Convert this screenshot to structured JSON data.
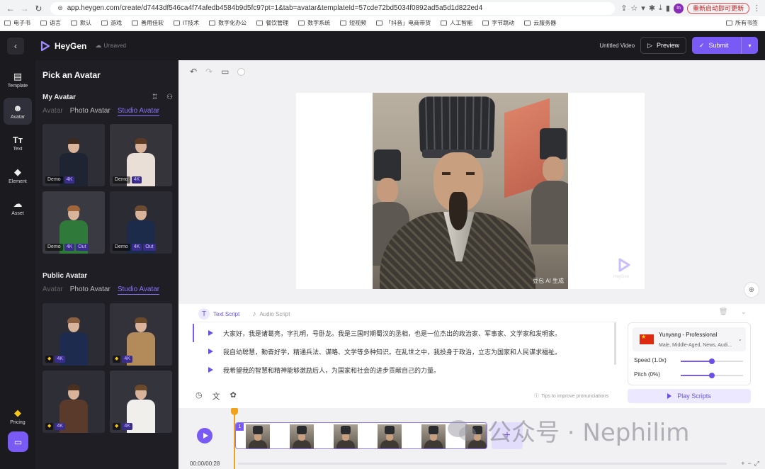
{
  "browser": {
    "url": "app.heygen.com/create/d7443df546ca4f74afedb4584b9d5fc9?pt=1&tab=avatar&templateId=57cde72bd5034f0892ad5a5d1d822ed4",
    "profile_initials": "In",
    "restart_label": "重新启动即可更新",
    "bookmarks": [
      "电子书",
      "语言",
      "默认",
      "游戏",
      "善用佳软",
      "IT技术",
      "数字化办公",
      "餐饮管理",
      "数字系统",
      "短视频",
      "「抖音」电商带货",
      "人工智能",
      "字节跳动",
      "云服务器"
    ],
    "bookmarks_right": "所有书签"
  },
  "header": {
    "brand": "HeyGen",
    "save_status": "Unsaved",
    "video_title": "Untitled Video",
    "preview_label": "Preview",
    "submit_label": "Submit"
  },
  "rail": {
    "items": [
      {
        "label": "Template",
        "icon": "template-icon"
      },
      {
        "label": "Avatar",
        "icon": "avatar-icon"
      },
      {
        "label": "Text",
        "icon": "text-icon"
      },
      {
        "label": "Element",
        "icon": "element-icon"
      },
      {
        "label": "Asset",
        "icon": "asset-icon"
      }
    ],
    "pricing_label": "Pricing"
  },
  "panel": {
    "title": "Pick an Avatar",
    "my_avatar": {
      "title": "My Avatar",
      "tabs": [
        "Avatar",
        "Photo Avatar",
        "Studio Avatar"
      ],
      "cards": [
        {
          "badges": [
            "Demo",
            "4K"
          ]
        },
        {
          "badges": [
            "Demo",
            "4K"
          ]
        },
        {
          "badges": [
            "Demo",
            "4K",
            "Out"
          ]
        },
        {
          "badges": [
            "Demo",
            "4K",
            "Out"
          ]
        }
      ]
    },
    "public_avatar": {
      "title": "Public Avatar",
      "tabs": [
        "Avatar",
        "Photo Avatar",
        "Studio Avatar"
      ],
      "cards": [
        {
          "badges": [
            "4K"
          ]
        },
        {
          "badges": [
            "4K"
          ]
        },
        {
          "badges": [
            "4K"
          ]
        },
        {
          "badges": [
            "4K"
          ]
        }
      ]
    }
  },
  "canvas": {
    "photo_caption": "豆包 AI 生成",
    "watermark": "HeyGen"
  },
  "script": {
    "tab_text": "Text Script",
    "tab_audio": "Audio Script",
    "lines": [
      "大家好，我是诸葛亮，字孔明，号卧龙。我是三国时期蜀汉的丞相，也是一位杰出的政治家、军事家、文学家和发明家。",
      "我自幼聪慧，勤奋好学，精通兵法、谋略、文学等多种知识。在乱世之中，我投身于政治，立志为国家和人民谋求福祉。",
      "我希望我的智慧和精神能够激励后人，为国家和社会的进步贡献自己的力量。"
    ],
    "tips": "Tips to improve pronunciations"
  },
  "voice": {
    "name": "Yunyang - Professional",
    "description": "Male, Middle-Aged, News, Audi...",
    "speed_label": "Speed (1.0x)",
    "speed_value": 0.5,
    "pitch_label": "Pitch (0%)",
    "pitch_value": 0.5,
    "play_label": "Play Scripts"
  },
  "timeline": {
    "time": "00:00/00:28",
    "clip_number": "1"
  },
  "watermark": {
    "text": "公众号 · Nephilim"
  },
  "colors": {
    "accent": "#7a5af5",
    "dark_bg": "#1a1a1f",
    "playhead": "#f0a21a"
  }
}
